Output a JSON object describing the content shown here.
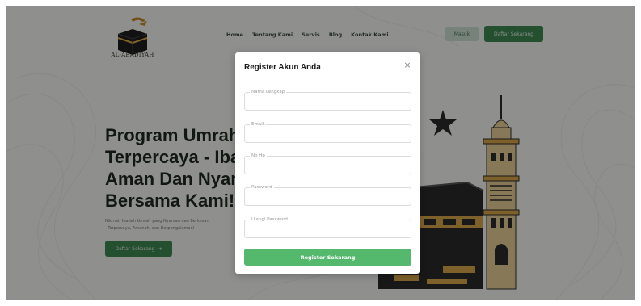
{
  "header": {
    "logo_text": "AL-ABADIYAH",
    "nav": [
      "Home",
      "Tentang Kami",
      "Servis",
      "Blog",
      "Kontak Kami"
    ],
    "login_label": "Masuk",
    "register_label": "Daftar Sekarang"
  },
  "hero": {
    "title_lines": [
      "Program Umrah",
      "Terpercaya - Ibadah",
      "Aman Dan Nyaman",
      "Bersama Kami!"
    ],
    "subtitle_lines": [
      "Nikmati Ibadah Umrah yang Nyaman dan Berkesan",
      "- Terpercaya, Amanah, dan Berpengalaman!"
    ],
    "cta_label": "Daftar Sekarang",
    "cta_arrow": "➜"
  },
  "modal": {
    "title": "Register Akun Anda",
    "close_icon": "×",
    "fields": [
      {
        "label": "Nama Lengkap",
        "value": ""
      },
      {
        "label": "Email",
        "value": ""
      },
      {
        "label": "No Hp",
        "value": ""
      },
      {
        "label": "Password",
        "value": ""
      },
      {
        "label": "Ulangi Password",
        "value": ""
      }
    ],
    "submit_label": "Register Sekarang"
  },
  "colors": {
    "primary": "#3f8a53",
    "submit": "#55b96d",
    "kaaba": "#2a2a2a",
    "gold": "#d9a64a",
    "minaret": "#e8cf96"
  }
}
